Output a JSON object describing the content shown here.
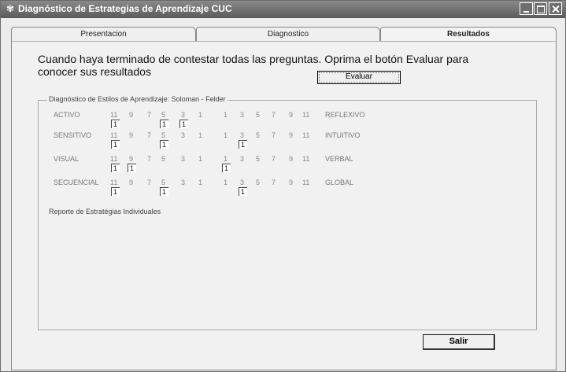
{
  "window": {
    "title": "Diagnóstico de Estrategias de Aprendizaje  CUC",
    "app_icon": "globe-icon"
  },
  "tabs": [
    "Presentacion",
    "Diagnostico",
    "Resultados"
  ],
  "active_tab": "Resultados",
  "message": "Cuando haya terminado de contestar todas las preguntas. Oprima el botón Evaluar para conocer sus resultados",
  "evaluate_label": "Evaluar",
  "group_title": "Diagnóstico de Estilos de Aprendizaje: Soloman - Felder",
  "scale": [
    "11",
    "9",
    "7",
    "5",
    "3",
    "1",
    "1",
    "3",
    "5",
    "7",
    "9",
    "11"
  ],
  "rows": [
    {
      "left": "ACTIVO",
      "right": "REFLEXIVO",
      "marks": [
        {
          "value": "1",
          "position": 0
        },
        {
          "value": "1",
          "position": 3
        },
        {
          "value": "1",
          "position": 4
        }
      ]
    },
    {
      "left": "SENSITIVO",
      "right": "INTUITIVO",
      "marks": [
        {
          "value": "1",
          "position": 0
        },
        {
          "value": "1",
          "position": 3
        },
        {
          "value": "1",
          "position": 7
        }
      ]
    },
    {
      "left": "VISUAL",
      "right": "VERBAL",
      "marks": [
        {
          "value": "1",
          "position": 0
        },
        {
          "value": "1",
          "position": 1
        },
        {
          "value": "1",
          "position": 6
        }
      ]
    },
    {
      "left": "SECUENCIAL",
      "right": "GLOBAL",
      "marks": [
        {
          "value": "1",
          "position": 0
        },
        {
          "value": "1",
          "position": 3
        },
        {
          "value": "1",
          "position": 7
        }
      ]
    }
  ],
  "report_label": "Reporte de Estratégias Individuales",
  "exit_label": "Salir"
}
